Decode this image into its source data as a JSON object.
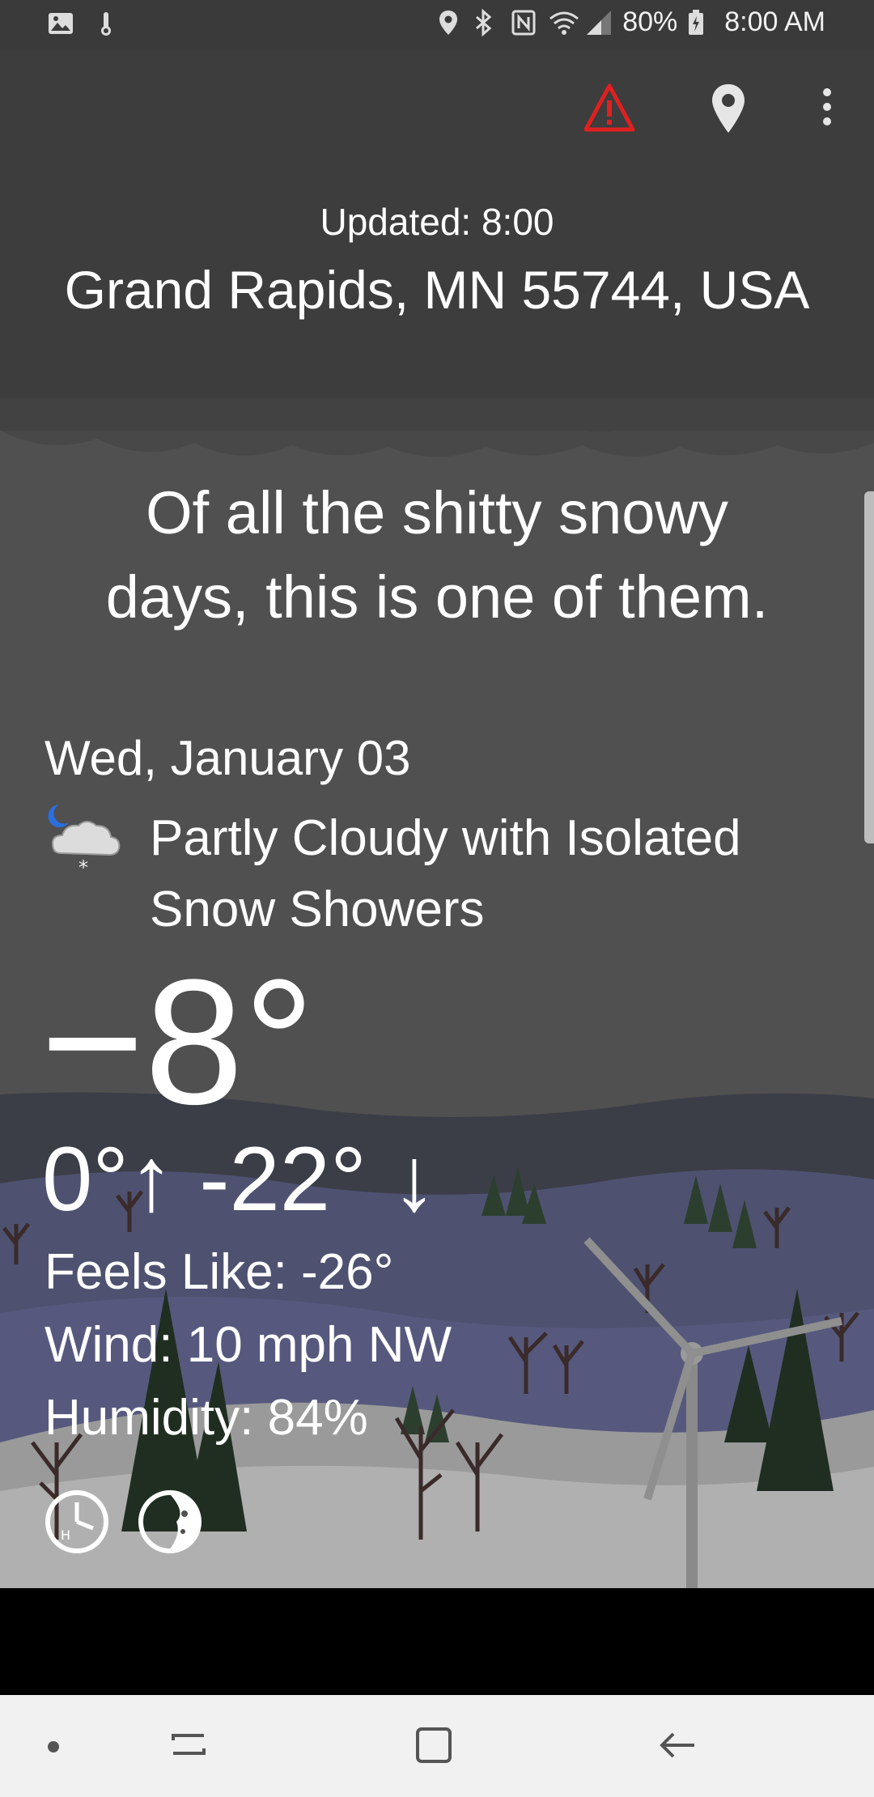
{
  "status_bar": {
    "battery": "80%",
    "time": "8:00 AM",
    "icons_left": [
      "image-icon",
      "thermometer-icon"
    ],
    "icons_right": [
      "location-icon",
      "bluetooth-icon",
      "nfc-icon",
      "wifi-icon",
      "signal-icon",
      "battery-icon"
    ]
  },
  "toolbar": {
    "alert_icon": "warning-triangle-icon",
    "location_icon": "map-pin-icon",
    "menu_icon": "overflow-menu-icon",
    "alert_color": "#e02020"
  },
  "header": {
    "updated": "Updated: 8:00",
    "location": "Grand Rapids, MN 55744, USA"
  },
  "quip": {
    "line1": "Of all the shitty snowy",
    "line2": "days, this is one of them."
  },
  "forecast": {
    "date": "Wed, January 03",
    "condition_icon": "partly-cloudy-night-snow-icon",
    "condition_line1": "Partly Cloudy with Isolated",
    "condition_line2": "Snow Showers",
    "temperature": "−8°",
    "high": "0°",
    "low": "-22°",
    "feels_like": "Feels Like: -26°",
    "wind": "Wind: 10 mph NW",
    "humidity": "Humidity: 84%"
  },
  "bottom_buttons": [
    "hourly-forecast-icon",
    "radar-icon"
  ],
  "nav_bar": {
    "icons": [
      "dot-icon",
      "recents-icon",
      "home-icon",
      "back-icon"
    ],
    "background": "#f1f1f1"
  }
}
